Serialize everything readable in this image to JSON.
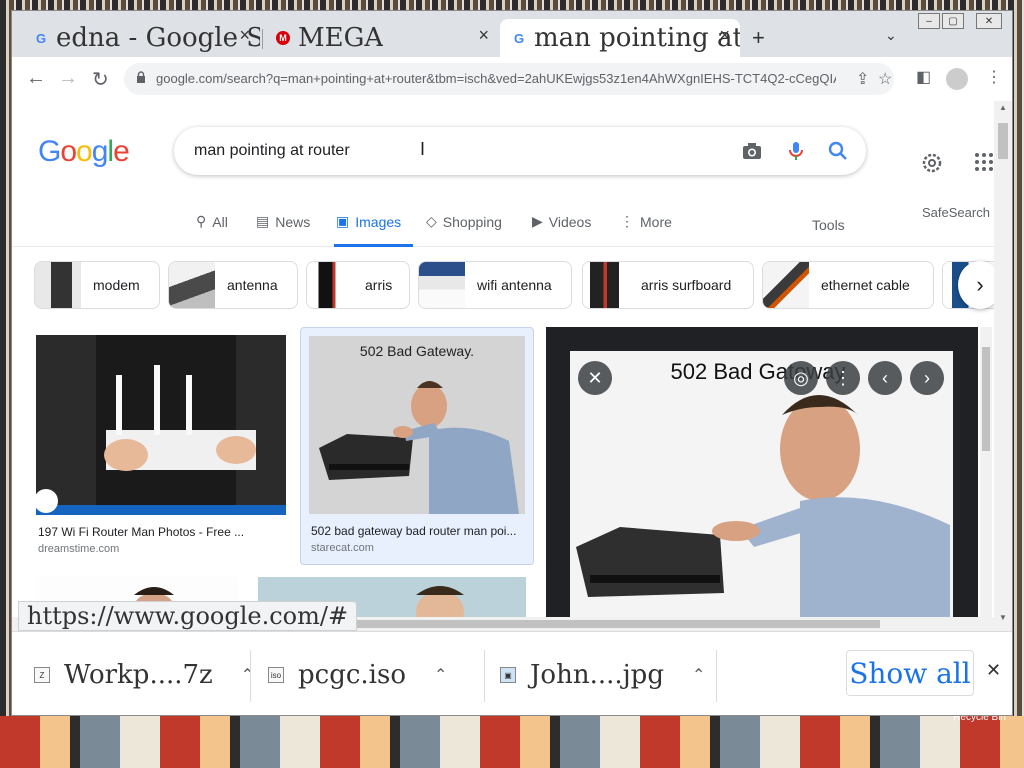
{
  "browser": {
    "tabs": [
      {
        "title": "edna - Google S",
        "favicon": "google-icon"
      },
      {
        "title": "MEGA",
        "favicon": "mega-icon"
      },
      {
        "title": "man pointing at",
        "favicon": "google-icon",
        "active": true
      }
    ],
    "new_tab": "+",
    "url": "google.com/search?q=man+pointing+at+router&tbm=isch&ved=2ahUKEwjgs53z1en4AhWXgnIEHS-TCT4Q2-cCegQIABA..."
  },
  "google": {
    "logo": [
      "G",
      "o",
      "o",
      "g",
      "l",
      "e"
    ],
    "logo_colors": [
      "#4285f4",
      "#ea4335",
      "#fbbc05",
      "#4285f4",
      "#34a853",
      "#ea4335"
    ],
    "query": "man pointing at router",
    "tabs": [
      "All",
      "News",
      "Images",
      "Shopping",
      "Videos",
      "More"
    ],
    "active_tab": "Images",
    "tools": "Tools",
    "safesearch": "SafeSearch"
  },
  "chips": [
    "modem",
    "antenna",
    "arris",
    "wifi antenna",
    "arris surfboard",
    "ethernet cable"
  ],
  "results": [
    {
      "title": "197 Wi Fi Router Man Photos - Free ...",
      "source": "dreamstime.com"
    },
    {
      "title": "502 bad gateway bad router man poi...",
      "source": "starecat.com",
      "image_text": "502 Bad Gateway."
    }
  ],
  "preview": {
    "image_text": "502 Bad Gateway"
  },
  "status_url": "https://www.google.com/#",
  "downloads": [
    {
      "name": "Workp....7z",
      "icon": "zip-icon"
    },
    {
      "name": "pcgc.iso",
      "icon": "iso-icon"
    },
    {
      "name": "John....jpg",
      "icon": "image-file-icon"
    }
  ],
  "show_all": "Show all",
  "desktop": {
    "recycle_bin": "Recycle Bin"
  },
  "colors": {
    "accent": "#1a73e8",
    "tab_strip": "#dee1e6"
  }
}
